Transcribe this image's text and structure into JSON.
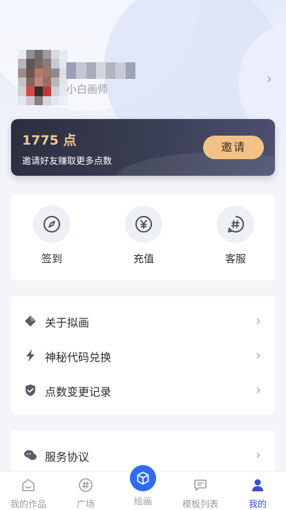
{
  "profile": {
    "nickname_pixels": [
      "#9aa0b3",
      "#c4c7d3",
      "#a8acbb",
      "#d3d5de",
      "#b1b4c2",
      "#c9cbd6",
      "#9fa3b4"
    ],
    "role": "小白画师"
  },
  "points": {
    "value": "1775 点",
    "subtitle": "邀请好友赚取更多点数",
    "invite_label": "邀请"
  },
  "quick_actions": [
    {
      "label": "签到",
      "icon": "compass-icon"
    },
    {
      "label": "充值",
      "icon": "yen-icon"
    },
    {
      "label": "客服",
      "icon": "hash-chat-icon"
    }
  ],
  "menu_group_1": [
    {
      "label": "关于拟画",
      "icon": "diamond-icon"
    },
    {
      "label": "神秘代码兑换",
      "icon": "lightning-icon"
    },
    {
      "label": "点数变更记录",
      "icon": "shield-icon"
    }
  ],
  "menu_group_2": [
    {
      "label": "服务协议",
      "icon": "chat-bubbles-icon"
    }
  ],
  "tabbar": [
    {
      "label": "我的作品",
      "icon": "home-icon"
    },
    {
      "label": "广场",
      "icon": "hash-icon"
    },
    {
      "label": "绘画",
      "icon": "cube-icon"
    },
    {
      "label": "模板列表",
      "icon": "message-icon"
    },
    {
      "label": "我的",
      "icon": "user-icon",
      "active": true
    }
  ],
  "colors": {
    "accent": "#3a4fd0",
    "gold": "#f2c793",
    "invite_button": "#f2c289",
    "card_dark": "#2c2e40"
  }
}
